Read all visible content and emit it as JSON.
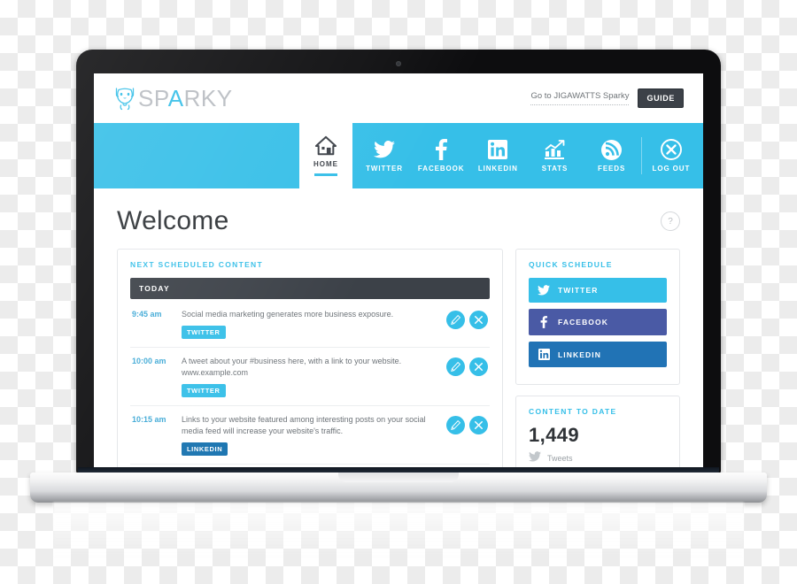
{
  "app": {
    "logo_prefix": "SP",
    "logo_highlight": "A",
    "logo_suffix": "RKY",
    "logo_icon": "dog-face-icon",
    "goto_label": "Go to JIGAWATTS Sparky",
    "guide_label": "GUIDE"
  },
  "nav": {
    "home": {
      "label": "HOME",
      "icon": "home-icon"
    },
    "items": [
      {
        "label": "TWITTER",
        "icon": "twitter-icon"
      },
      {
        "label": "FACEBOOK",
        "icon": "facebook-icon"
      },
      {
        "label": "LINKEDIN",
        "icon": "linkedin-icon"
      },
      {
        "label": "STATS",
        "icon": "bar-chart-icon"
      },
      {
        "label": "FEEDS",
        "icon": "rss-icon"
      },
      {
        "label": "LOG OUT",
        "icon": "close-circle-icon"
      }
    ]
  },
  "page": {
    "title": "Welcome",
    "help_label": "?"
  },
  "scheduled": {
    "card_title": "NEXT SCHEDULED CONTENT",
    "day_label": "TODAY",
    "edit_icon": "pencil-icon",
    "delete_icon": "close-icon",
    "rows": [
      {
        "time": "9:45 am",
        "text": "Social media marketing generates more business exposure.",
        "badge": "TWITTER",
        "network": "twitter"
      },
      {
        "time": "10:00 am",
        "text": "A tweet about your #business here, with a link to your website. www.example.com",
        "badge": "TWITTER",
        "network": "twitter"
      },
      {
        "time": "10:15 am",
        "text": "Links to your website featured among interesting posts on your social media feed will increase your website's traffic.",
        "badge": "LINKEDIN",
        "network": "linkedin"
      }
    ]
  },
  "quick_schedule": {
    "card_title": "QUICK SCHEDULE",
    "buttons": [
      {
        "label": "TWITTER",
        "icon": "twitter-icon",
        "color": "#36bfe8"
      },
      {
        "label": "FACEBOOK",
        "icon": "facebook-icon",
        "color": "#4a5aa5"
      },
      {
        "label": "LINKEDIN",
        "icon": "linkedin-icon",
        "color": "#2173b5"
      }
    ]
  },
  "content_to_date": {
    "card_title": "CONTENT TO DATE",
    "value": "1,449",
    "label": "Tweets",
    "icon": "twitter-icon"
  },
  "colors": {
    "accent": "#36bfe8",
    "dark": "#3c4148",
    "facebook": "#4a5aa5",
    "linkedin": "#1a74b0"
  }
}
